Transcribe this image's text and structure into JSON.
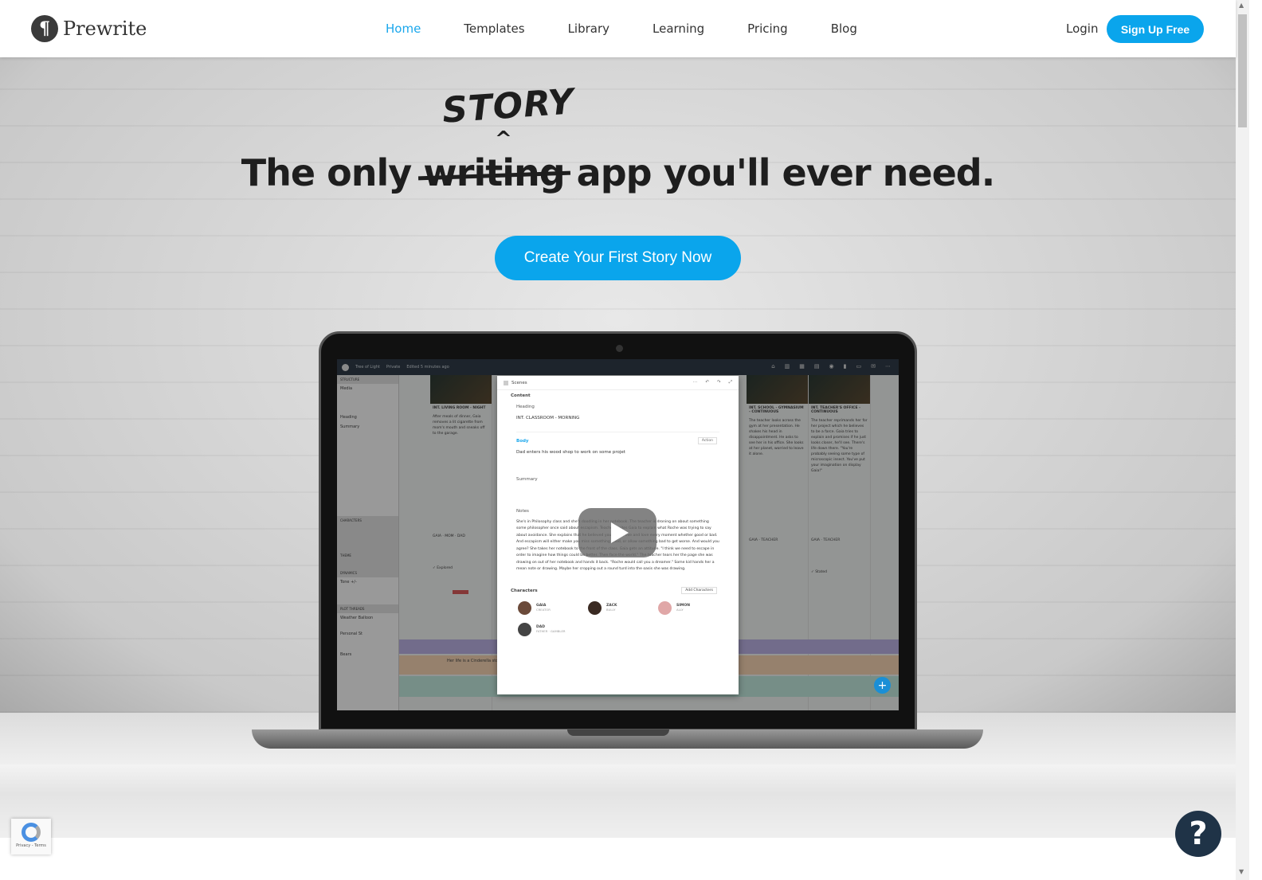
{
  "header": {
    "brand": "Prewrite",
    "logo_glyph": "¶",
    "nav": [
      {
        "label": "Home",
        "active": true
      },
      {
        "label": "Templates"
      },
      {
        "label": "Library"
      },
      {
        "label": "Learning"
      },
      {
        "label": "Pricing"
      },
      {
        "label": "Blog"
      }
    ],
    "login": "Login",
    "signup": "Sign Up Free"
  },
  "hero": {
    "headline_before": "The only ",
    "struck_word": "writing",
    "headline_after": " app you'll ever need.",
    "replacement_word": "STORY",
    "caret": "^",
    "cta": "Create Your First Story Now"
  },
  "app": {
    "project": "Tree of Light",
    "visibility": "Private",
    "edited": "Edited 5 minutes ago",
    "sidebar": [
      "STRUCTURE",
      "Media",
      "Heading",
      "Summary",
      "CHARACTERS",
      "THEME",
      "DYNAMICS",
      "Tone +/-",
      "PLOT THREADS",
      "Weather Balloon",
      "Personal St",
      "Bears"
    ],
    "columns": [
      {
        "heading": "INT. LIVING ROOM - NIGHT",
        "text": "After meals of dinner, Gaia removes a lit cigarette from mom's mouth and sneaks off to the garage.",
        "chars": "GAIA · MOM · DAD",
        "theme": "✓ Explored"
      },
      {
        "heading": "INT. SCHOOL - GYMNASIUM - CONTINUOUS",
        "text": "The teacher looks across the gym at her presentation. He shakes his head in disappointment. He asks to see her in his office. She looks at her planet, worried to leave it alone.",
        "chars": "GAIA · TEACHER",
        "theme": ""
      },
      {
        "heading": "INT. TEACHER'S OFFICE - CONTINUOUS",
        "text": "The teacher reprimands her for her project which he believes to be a farce. Gaia tries to explain and promises if he just looks closer, he'll see. There's life down there. \"You're probably seeing some type of microscopic insect. You've put your imagination on display Gaia!\"",
        "chars": "GAIA · TEACHER",
        "theme": "✓ Stated"
      }
    ],
    "thread_text": "Her life is a Cinderella story."
  },
  "modal": {
    "title": "Scenes",
    "content": "Content",
    "heading_label": "Heading",
    "heading_value": "INT. CLASSROOM - MORNING",
    "body_label": "Body",
    "body_type": "Action",
    "body_value": "Dad enters his wood shop to work on some projet",
    "summary_label": "Summary",
    "notes_label": "Notes",
    "notes_value": "She's in Philosophy class and she's doodling in her notebook. The teacher is droning on about something some philosopher once said about escapism. Teacher invites Gaia to explain what Roche was trying to say about avoidance. She explains that he believed you had to live and love every moment whether good or bad. And escapism will either make you miss something good, or allow something bad to get worse. And would you agree? She takes her notebook to the front of the class. Gaia gets an attitude. \"I think we need to escape in order to imagine how things could be better. Then face the world.\" The teacher tears her the page she was drawing on out of her notebook and hands it back. \"Roche would call you a dreamer.\" Some kid hands her a mean note or drawing. Maybe her cropping out a round turd into the oasis she was drawing.",
    "characters_label": "Characters",
    "add_characters": "Add Characters",
    "characters": [
      {
        "name": "GAIA",
        "role": "CREATOR"
      },
      {
        "name": "ZACK",
        "role": "BULLY"
      },
      {
        "name": "SIMON",
        "role": "ALLY"
      },
      {
        "name": "DAD",
        "role": "FATHER · GAMBLER"
      }
    ]
  },
  "recaptcha": "Privacy - Terms",
  "help_glyph": "?",
  "colors": {
    "accent": "#0aa5ec",
    "help": "#1f3347"
  }
}
